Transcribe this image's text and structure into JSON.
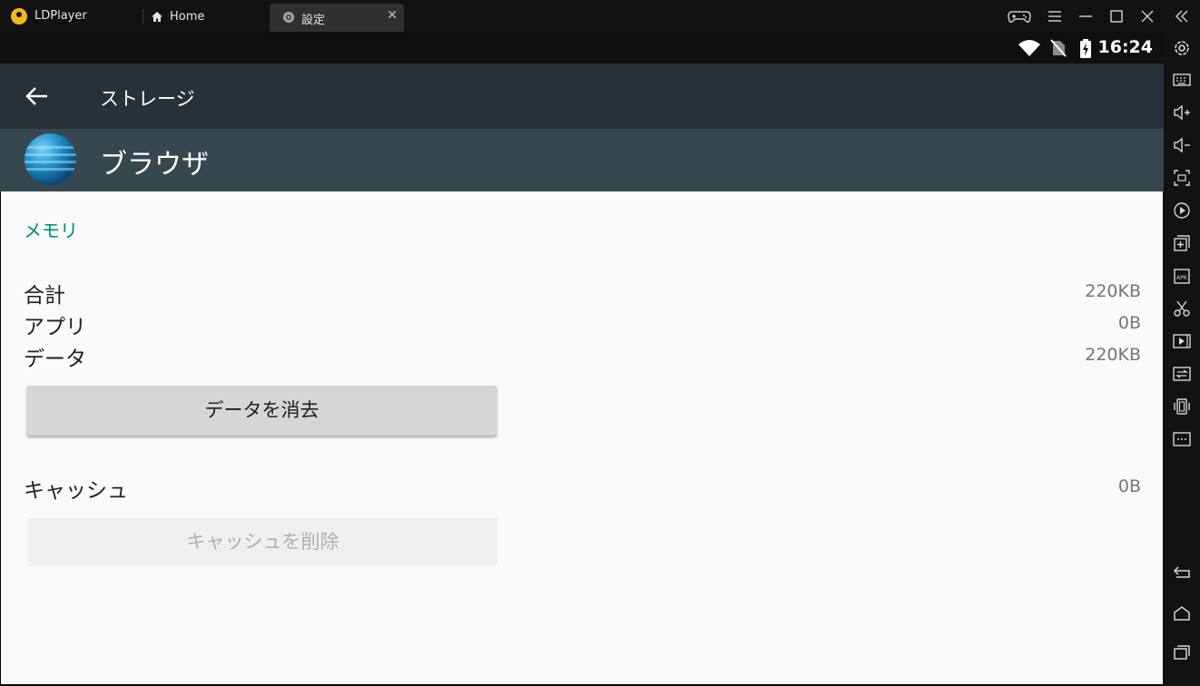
{
  "window": {
    "app_name": "LDPlayer",
    "tabs": [
      {
        "label": "Home",
        "icon": "home-icon"
      },
      {
        "label": "設定",
        "icon": "settings-icon",
        "close": "✕"
      }
    ],
    "controls": [
      "gamepad-icon",
      "menu-icon",
      "minimize-icon",
      "maximize-icon",
      "close-icon",
      "collapse-icon"
    ]
  },
  "statusbar": {
    "time": "16:24",
    "icons": [
      "wifi-icon",
      "no-sim-icon",
      "battery-charging-icon"
    ]
  },
  "appbar": {
    "title": "ストレージ",
    "back_icon": "back-arrow-icon"
  },
  "app_header": {
    "name": "ブラウザ",
    "icon": "browser-globe-icon"
  },
  "memory": {
    "section_title": "メモリ",
    "total_label": "合計",
    "total_value": "220KB",
    "app_label": "アプリ",
    "app_value": "0B",
    "data_label": "データ",
    "data_value": "220KB",
    "clear_data_button": "データを消去",
    "cache_label": "キャッシュ",
    "cache_value": "0B",
    "clear_cache_button": "キャッシュを削除"
  },
  "toolbar": [
    "settings-icon",
    "keyboard-icon",
    "volume-up-icon",
    "volume-down-icon",
    "fullscreen-icon",
    "record-icon",
    "multi-instance-icon",
    "apk-icon",
    "scissors-icon",
    "video-icon",
    "sync-icon",
    "shake-icon",
    "more-icon",
    "back-icon",
    "home-icon",
    "recent-apps-icon"
  ],
  "colors": {
    "accent": "#00897b",
    "appbar": "#263238",
    "header": "#37474f",
    "chrome": "#121212"
  }
}
